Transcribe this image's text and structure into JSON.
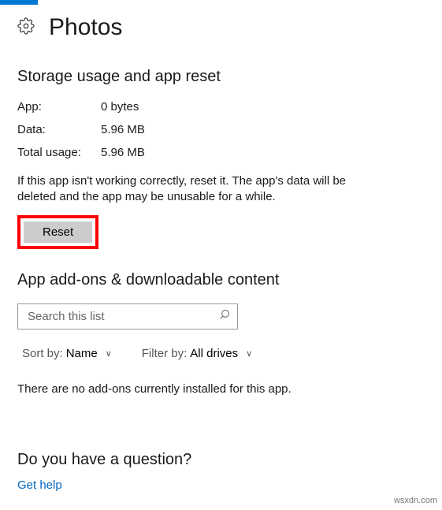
{
  "header": {
    "title": "Photos"
  },
  "storage": {
    "heading": "Storage usage and app reset",
    "rows": {
      "app": {
        "label": "App:",
        "value": "0 bytes"
      },
      "data": {
        "label": "Data:",
        "value": "5.96 MB"
      },
      "total": {
        "label": "Total usage:",
        "value": "5.96 MB"
      }
    },
    "reset_desc": "If this app isn't working correctly, reset it. The app's data will be deleted and the app may be unusable for a while.",
    "reset_label": "Reset"
  },
  "addons": {
    "heading": "App add-ons & downloadable content",
    "search_placeholder": "Search this list",
    "sort_label": "Sort by:",
    "sort_value": "Name",
    "filter_label": "Filter by:",
    "filter_value": "All drives",
    "empty_text": "There are no add-ons currently installed for this app."
  },
  "question": {
    "heading": "Do you have a question?",
    "link": "Get help"
  },
  "watermark": "wsxdn.com"
}
